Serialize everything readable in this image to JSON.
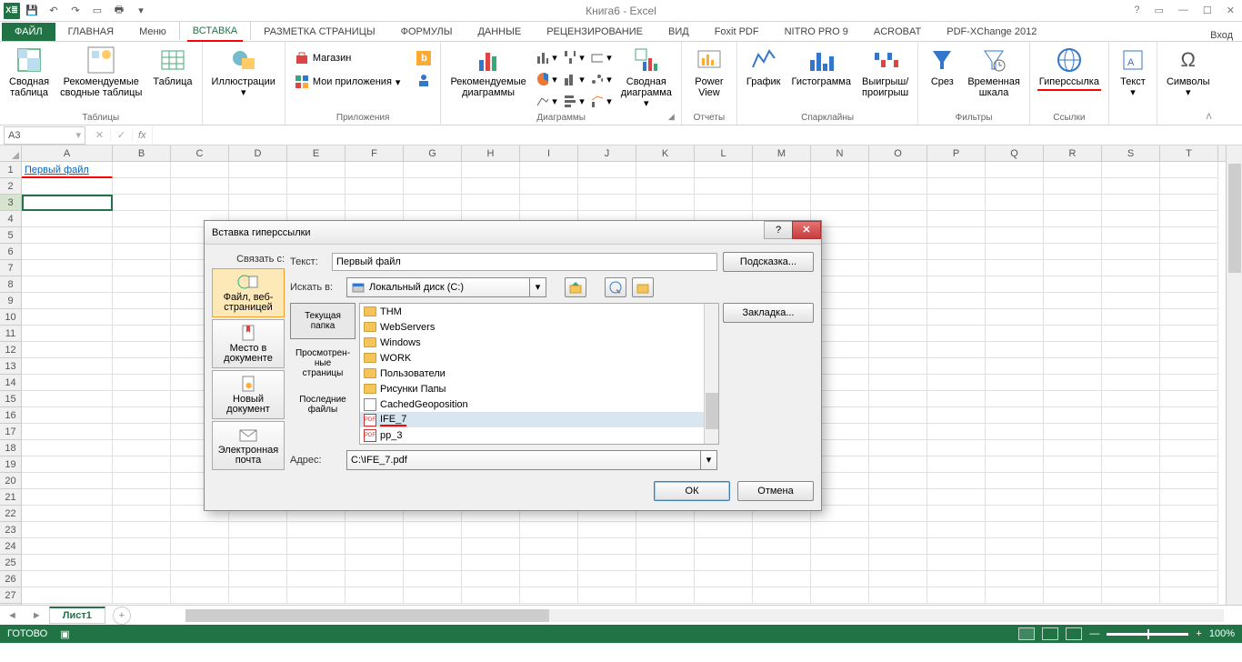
{
  "app": {
    "title": "Книга6 - Excel",
    "signin": "Вход"
  },
  "qat_file_label": "ФАЙЛ",
  "tabs": {
    "home": "ГЛАВНАЯ",
    "menu": "Меню",
    "insert": "ВСТАВКА",
    "layout": "РАЗМЕТКА СТРАНИЦЫ",
    "formulas": "ФОРМУЛЫ",
    "data": "ДАННЫЕ",
    "review": "РЕЦЕНЗИРОВАНИЕ",
    "view": "ВИД",
    "foxit": "Foxit PDF",
    "nitro": "NITRO PRO 9",
    "acrobat": "ACROBAT",
    "pdfx": "PDF-XChange 2012"
  },
  "ribbon": {
    "tables": {
      "pivot": "Сводная\nтаблица",
      "rec": "Рекомендуемые\nсводные таблицы",
      "table": "Таблица",
      "group": "Таблицы"
    },
    "illus": {
      "btn": "Иллюстрации"
    },
    "apps": {
      "store": "Магазин",
      "my": "Мои приложения",
      "group": "Приложения"
    },
    "charts": {
      "rec": "Рекомендуемые\nдиаграммы",
      "pivotchart": "Сводная\nдиаграмма",
      "group": "Диаграммы"
    },
    "reports": {
      "power": "Power\nView",
      "group": "Отчеты"
    },
    "spark": {
      "line": "График",
      "col": "Гистограмма",
      "winloss": "Выигрыш/\nпроигрыш",
      "group": "Спарклайны"
    },
    "filters": {
      "slicer": "Срез",
      "timeline": "Временная\nшкала",
      "group": "Фильтры"
    },
    "links": {
      "hyper": "Гиперссылка",
      "group": "Ссылки"
    },
    "text": {
      "btn": "Текст"
    },
    "symbols": {
      "btn": "Символы"
    }
  },
  "namebox": "A3",
  "columns": [
    "A",
    "B",
    "C",
    "D",
    "E",
    "F",
    "G",
    "H",
    "I",
    "J",
    "K",
    "L",
    "M",
    "N",
    "O",
    "P",
    "Q",
    "R",
    "S",
    "T"
  ],
  "rows": [
    "1",
    "2",
    "3",
    "4",
    "5",
    "6",
    "7",
    "8",
    "9",
    "10",
    "11",
    "12",
    "13",
    "14",
    "15",
    "16",
    "17",
    "18",
    "19",
    "20",
    "21",
    "22",
    "23",
    "24",
    "25",
    "26",
    "27"
  ],
  "cellA1": "Первый файл",
  "sheet": {
    "name": "Лист1"
  },
  "status": {
    "ready": "ГОТОВО",
    "zoom": "100%"
  },
  "dialog": {
    "title": "Вставка гиперссылки",
    "linkto": "Связать с:",
    "lt_web": "Файл, веб-\nстраницей",
    "lt_doc": "Место в\nдокументе",
    "lt_new": "Новый\nдокумент",
    "lt_mail": "Электронная\nпочта",
    "text_lbl": "Текст:",
    "text_val": "Первый файл",
    "tip": "Подсказка...",
    "lookin": "Искать в:",
    "lookin_val": "Локальный диск (C:)",
    "bookmark": "Закладка...",
    "cur": "Текущая\nпапка",
    "browsed": "Просмотрен-\nные\nстраницы",
    "recent": "Последние\nфайлы",
    "files": [
      {
        "n": "THM",
        "t": "folder"
      },
      {
        "n": "WebServers",
        "t": "folder"
      },
      {
        "n": "Windows",
        "t": "folder"
      },
      {
        "n": "WORK",
        "t": "folder"
      },
      {
        "n": "Пользователи",
        "t": "folder"
      },
      {
        "n": "Рисунки Папы",
        "t": "folder"
      },
      {
        "n": "CachedGeoposition",
        "t": "file"
      },
      {
        "n": "IFE_7",
        "t": "pdf",
        "sel": true
      },
      {
        "n": "pp_3",
        "t": "pdf"
      }
    ],
    "addr_lbl": "Адрес:",
    "addr_val": "C:\\IFE_7.pdf",
    "ok": "ОК",
    "cancel": "Отмена"
  }
}
